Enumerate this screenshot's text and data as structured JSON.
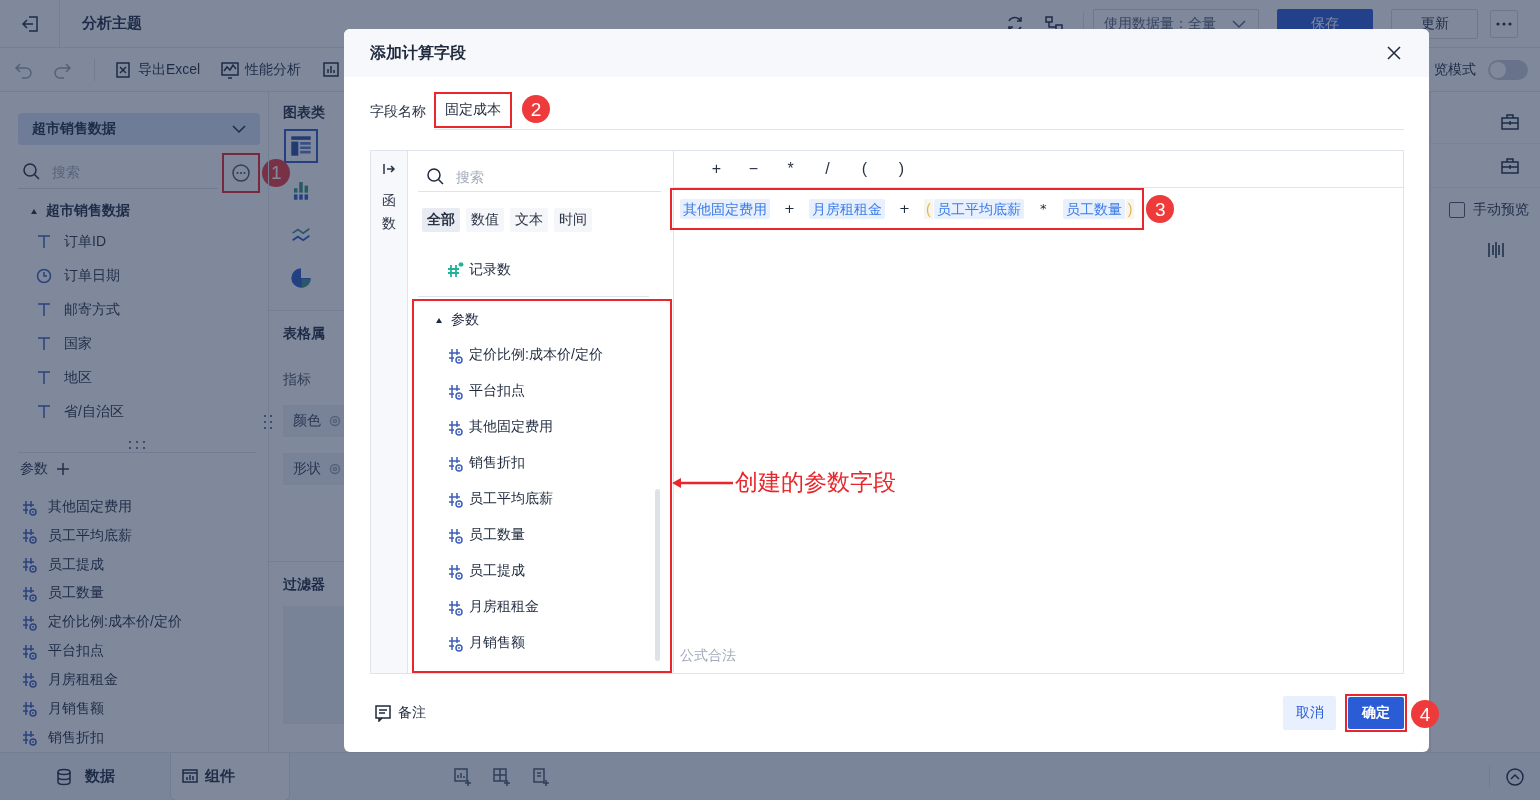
{
  "app_bar": {
    "title": "分析主题",
    "data_volume": "使用数据量：全量",
    "save": "保存",
    "update": "更新"
  },
  "toolbar": {
    "items": [
      {
        "kind": "excel",
        "label": "导出Excel"
      },
      {
        "kind": "performance",
        "label": "性能分析"
      },
      {
        "kind": "chart"
      }
    ],
    "preview_mode": {
      "label": "览模式",
      "on": false
    }
  },
  "data_panel": {
    "dataset": "超市销售数据",
    "search": {
      "placeholder": "搜索"
    },
    "more_callout": "1",
    "tree": [
      {
        "label": "超市销售数据",
        "expanded": true,
        "children": [
          {
            "label": "订单ID",
            "kind": "text"
          },
          {
            "label": "订单日期",
            "kind": "date"
          },
          {
            "label": "邮寄方式",
            "kind": "text"
          },
          {
            "label": "国家",
            "kind": "text"
          },
          {
            "label": "地区",
            "kind": "text"
          },
          {
            "label": "省/自治区",
            "kind": "text"
          }
        ]
      }
    ],
    "params": {
      "title": "参数",
      "items": [
        "其他固定费用",
        "员工平均底薪",
        "员工提成",
        "员工数量",
        "定价比例:成本价/定价",
        "平台扣点",
        "月房租租金",
        "月销售额",
        "销售折扣"
      ]
    }
  },
  "chart_panel": {
    "chart_types_title": "图表类",
    "chart_types": [
      {
        "kind": "table",
        "selected": true
      },
      {
        "kind": "bar",
        "selected": false
      },
      {
        "kind": "line",
        "selected": false
      },
      {
        "kind": "pie",
        "selected": false
      }
    ],
    "table_props_title": "表格属",
    "metric_label": "指标",
    "chips": [
      "颜色",
      "形状"
    ],
    "filter_title": "过滤器"
  },
  "side_panel": {
    "manual_preview": {
      "label": "手动预览",
      "checked": false
    }
  },
  "bottom_bar": {
    "tabs": [
      {
        "label": "数据",
        "kind": "data",
        "selected": false
      },
      {
        "label": "组件",
        "kind": "widget",
        "selected": true
      }
    ]
  },
  "dialog": {
    "title": "添加计算字段",
    "field_label": "字段名称",
    "field_value": "固定成本",
    "field_callout": "2",
    "rail_label": "函数",
    "function_search": {
      "placeholder": "搜索"
    },
    "filters": [
      {
        "label": "全部",
        "selected": true
      },
      {
        "label": "数值",
        "selected": false
      },
      {
        "label": "文本",
        "selected": false
      },
      {
        "label": "时间",
        "selected": false
      }
    ],
    "functions": [
      {
        "label": "记录数"
      }
    ],
    "param_group": {
      "label": "参数",
      "expanded": true,
      "children": [
        "定价比例:成本价/定价",
        "平台扣点",
        "其他固定费用",
        "销售折扣",
        "员工平均底薪",
        "员工数量",
        "员工提成",
        "月房租租金",
        "月销售额"
      ]
    },
    "param_callout": "创建的参数字段",
    "operators": [
      "+",
      "−",
      "*",
      "/",
      "(",
      ")"
    ],
    "formula": {
      "callout": "3",
      "tokens": [
        {
          "kind": "field",
          "text": "其他固定费用"
        },
        {
          "kind": "op",
          "text": "+"
        },
        {
          "kind": "field",
          "text": "月房租租金"
        },
        {
          "kind": "op",
          "text": "+"
        },
        {
          "kind": "paren",
          "text": "("
        },
        {
          "kind": "field",
          "text": "员工平均底薪"
        },
        {
          "kind": "op",
          "text": "*"
        },
        {
          "kind": "field",
          "text": "员工数量"
        },
        {
          "kind": "paren",
          "text": ")"
        }
      ]
    },
    "status": "公式合法",
    "note": "备注",
    "cancel": "取消",
    "confirm": "确定",
    "confirm_callout": "4"
  }
}
